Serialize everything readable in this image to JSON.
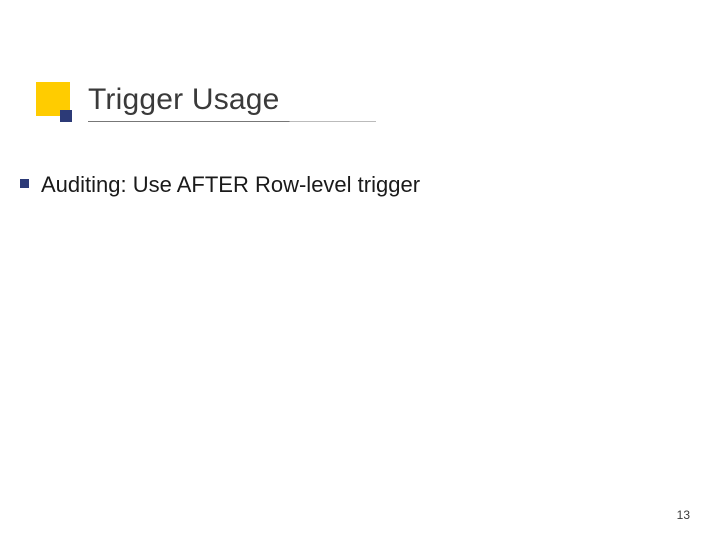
{
  "title": "Trigger Usage",
  "bullets": [
    "Auditing: Use AFTER Row-level trigger"
  ],
  "page_number": "13"
}
